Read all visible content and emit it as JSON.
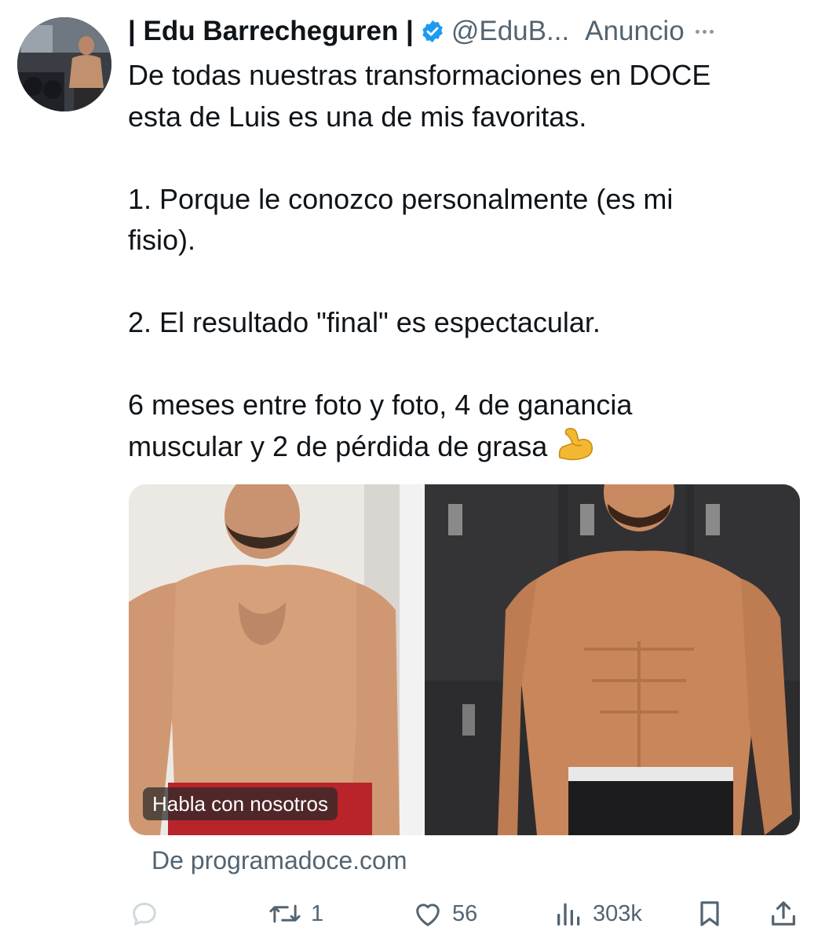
{
  "tweet": {
    "author": {
      "display_name": "| Edu Barrecheguren |",
      "handle": "@EduB...",
      "verified": true,
      "ad_label": "Anuncio"
    },
    "text": {
      "line1": "De todas nuestras transformaciones en DOCE",
      "line2": "esta de Luis es una de mis favoritas.",
      "line3": "1.  Porque le conozco personalmente (es mi",
      "line4": "fisio).",
      "line5": "2. El resultado \"final\" es espectacular.",
      "line6": "6 meses entre foto y foto, 4 de ganancia",
      "line7": "muscular y 2 de pérdida de grasa",
      "emoji": "flexed-biceps-icon"
    },
    "media": {
      "cta_label": "Habla con nosotros",
      "description": "before-after-photo"
    },
    "source": "De programadoce.com",
    "actions": {
      "reply_icon": "reply-icon",
      "retweet_count": "1",
      "like_count": "56",
      "view_count": "303k",
      "bookmark_icon": "bookmark-icon",
      "share_icon": "share-icon"
    },
    "colors": {
      "text": "#0f1419",
      "secondary": "#536471",
      "verified": "#1d9bf0"
    }
  }
}
